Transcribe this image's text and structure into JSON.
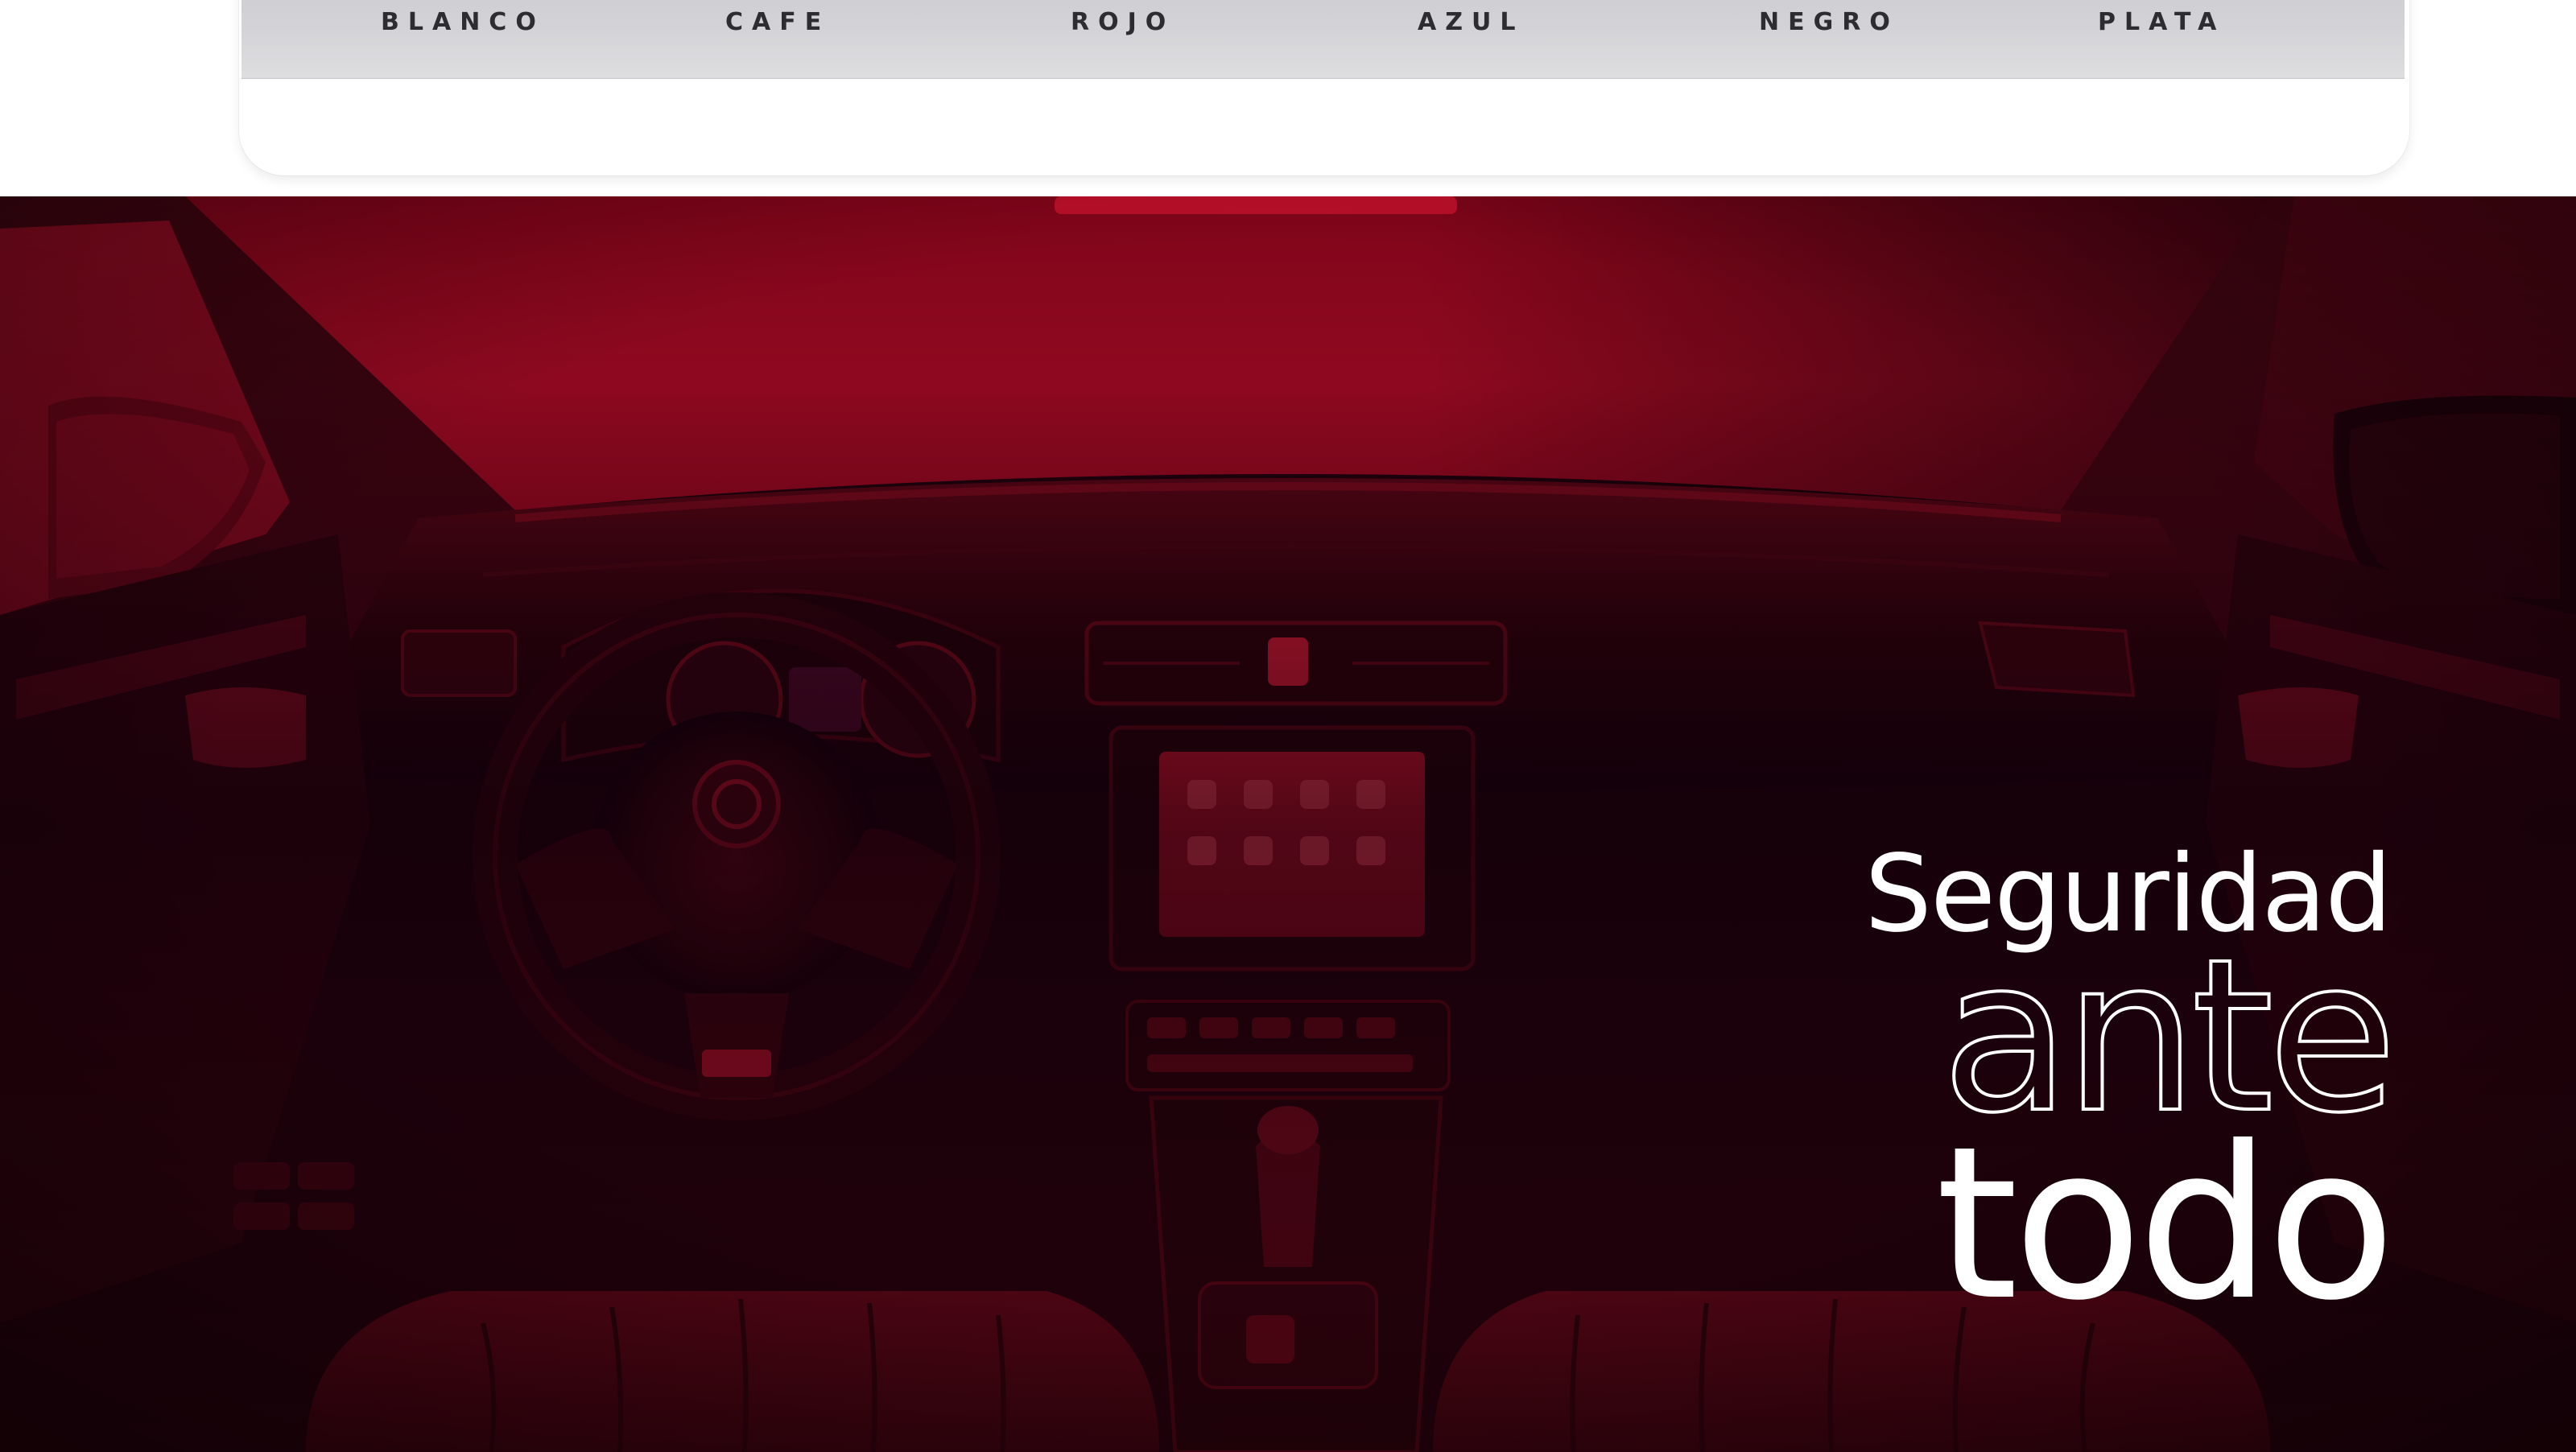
{
  "color_selector": {
    "options": [
      {
        "label": "BLANCO"
      },
      {
        "label": "CAFE"
      },
      {
        "label": "ROJO"
      },
      {
        "label": "AZUL"
      },
      {
        "label": "NEGRO"
      },
      {
        "label": "PLATA"
      }
    ]
  },
  "hero": {
    "tagline": {
      "line1": "Seguridad",
      "line2": "ante",
      "line3": "todo"
    },
    "accent_color": "#a30a22",
    "shadow_color": "#16010a"
  }
}
